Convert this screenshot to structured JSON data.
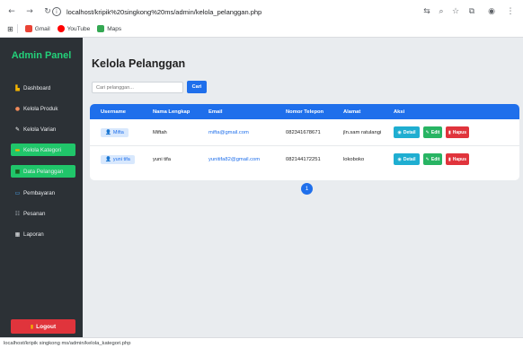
{
  "browser": {
    "url": "localhost/kripik%20singkong%20ms/admin/kelola_pelanggan.php",
    "bookmarks": [
      {
        "label": "Gmail"
      },
      {
        "label": "YouTube"
      },
      {
        "label": "Maps"
      }
    ],
    "status_url": "localhost/kripik singkong ms/admin/kelola_kategori.php"
  },
  "sidebar": {
    "brand": "Admin Panel",
    "items": [
      {
        "label": "Dashboard"
      },
      {
        "label": "Kelola Produk"
      },
      {
        "label": "Kelola Varian"
      },
      {
        "label": "Kelola Kategori"
      },
      {
        "label": "Data Pelanggan"
      },
      {
        "label": "Pembayaran"
      },
      {
        "label": "Pesanan"
      },
      {
        "label": "Laporan"
      }
    ],
    "logout": "Logout"
  },
  "main": {
    "title": "Kelola Pelanggan",
    "search_placeholder": "Cari pelanggan...",
    "search_button": "Cari",
    "columns": [
      "Username",
      "Nama Lengkap",
      "Email",
      "Nomor Telepon",
      "Alamat",
      "Aksi"
    ],
    "rows": [
      {
        "username": "Mifta",
        "nama": "Miftah",
        "email": "mifta@gmail.com",
        "telepon": "082341678671",
        "alamat": "jln.sam ratulangi"
      },
      {
        "username": "yuni tifa",
        "nama": "yuni tifa",
        "email": "yunitifa82@gmail.com",
        "telepon": "082144172251",
        "alamat": "lokoboko"
      }
    ],
    "actions": {
      "detail": "Detail",
      "edit": "Edit",
      "hapus": "Hapus"
    },
    "page": "1"
  },
  "colors": {
    "sidebar_bg": "#2c3136",
    "accent_green": "#20c66a",
    "primary_blue": "#1f6feb",
    "danger_red": "#e0343c",
    "info_cyan": "#1faed1"
  }
}
